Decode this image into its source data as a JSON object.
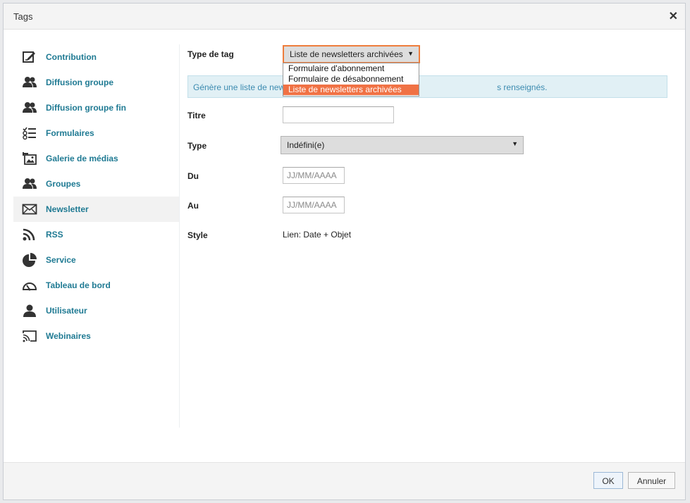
{
  "dialog": {
    "title": "Tags",
    "close_glyph": "✕",
    "ok_label": "OK",
    "cancel_label": "Annuler"
  },
  "sidebar": {
    "items": [
      {
        "label": "Contribution",
        "icon": "edit-icon"
      },
      {
        "label": "Diffusion groupe",
        "icon": "users-icon"
      },
      {
        "label": "Diffusion groupe fin",
        "icon": "users-icon"
      },
      {
        "label": "Formulaires",
        "icon": "checklist-icon"
      },
      {
        "label": "Galerie de médias",
        "icon": "gallery-icon"
      },
      {
        "label": "Groupes",
        "icon": "users-icon"
      },
      {
        "label": "Newsletter",
        "icon": "envelope-icon"
      },
      {
        "label": "RSS",
        "icon": "rss-icon"
      },
      {
        "label": "Service",
        "icon": "pie-chart-icon"
      },
      {
        "label": "Tableau de bord",
        "icon": "gauge-icon"
      },
      {
        "label": "Utilisateur",
        "icon": "user-icon"
      },
      {
        "label": "Webinaires",
        "icon": "cast-icon"
      }
    ],
    "active_index": 6
  },
  "form": {
    "tag_type_label": "Type de tag",
    "tag_type_value": "Liste de newsletters archivées",
    "tag_type_options": [
      "Formulaire d'abonnement",
      "Formulaire de désabonnement",
      "Liste de newsletters archivées"
    ],
    "info_text_start": "Génère une liste de new",
    "info_text_end": "s renseignés.",
    "title_label": "Titre",
    "title_value": "",
    "type_label": "Type",
    "type_value": "Indéfini(e)",
    "from_label": "Du",
    "from_placeholder": "JJ/MM/AAAA",
    "to_label": "Au",
    "to_placeholder": "JJ/MM/AAAA",
    "style_label": "Style",
    "style_value": "Lien: Date + Objet"
  },
  "colors": {
    "link": "#1f7a93",
    "accent": "#ee7d3c",
    "selected_option": "#f07245",
    "info_bg": "#e1f0f5",
    "info_text": "#3c8bb0"
  }
}
